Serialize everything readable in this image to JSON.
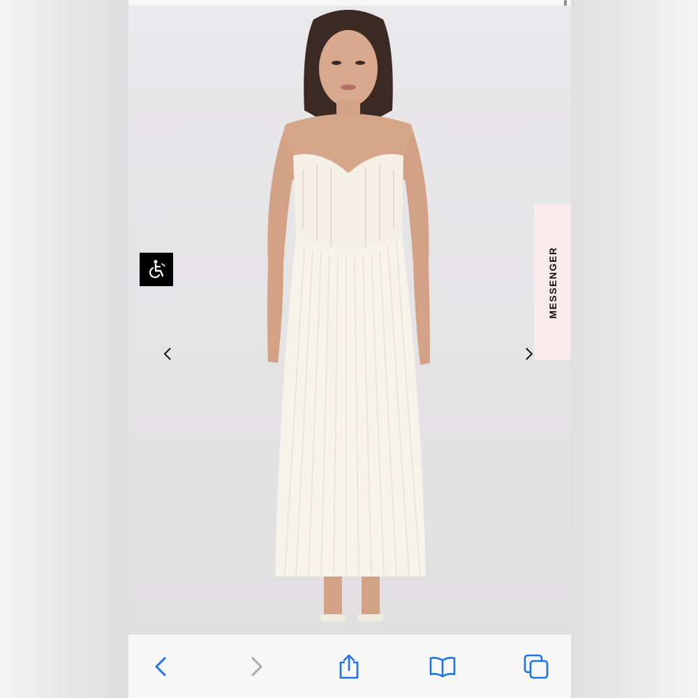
{
  "side_tab": {
    "label": "MESSENGER"
  },
  "product_image": {
    "description_icon": "product-photo",
    "dress_color": "#f6f3ea",
    "backdrop_color": "#e6e5e6"
  },
  "overlay_controls": {
    "accessibility_icon": "wheelchair-icon",
    "prev_icon": "chevron-left-icon",
    "next_icon": "chevron-right-icon"
  },
  "browser_toolbar": {
    "back_icon": "back-arrow-icon",
    "forward_icon": "forward-arrow-icon",
    "share_icon": "share-icon",
    "bookmarks_icon": "book-icon",
    "tabs_icon": "tabs-icon",
    "accent_color": "#1a73e8",
    "disabled_color": "#a9a9ad"
  }
}
